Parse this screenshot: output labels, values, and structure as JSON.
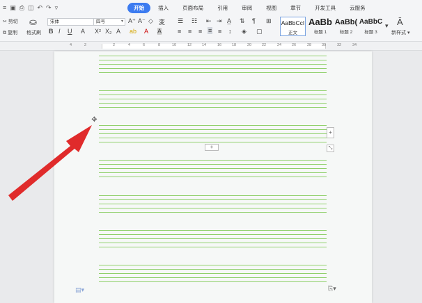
{
  "quick_access": {
    "icons": [
      "menu-icon",
      "save-icon",
      "print-icon",
      "preview-icon",
      "undo-icon",
      "redo-icon",
      "customize-icon"
    ]
  },
  "tabs": [
    {
      "label": "开始",
      "active": true
    },
    {
      "label": "插入"
    },
    {
      "label": "页面布局"
    },
    {
      "label": "引用"
    },
    {
      "label": "审阅"
    },
    {
      "label": "视图"
    },
    {
      "label": "章节"
    },
    {
      "label": "开发工具"
    },
    {
      "label": "云服务"
    }
  ],
  "ribbon": {
    "cut_label": "剪切",
    "copy_label": "复制",
    "format_painter_label": "格式刷",
    "font_name": "宋体",
    "font_size": "四号",
    "styles": [
      {
        "sample": "AaBbCcI",
        "caption": "正文"
      },
      {
        "sample": "AaBb",
        "caption": "标题 1"
      },
      {
        "sample": "AaBb(",
        "caption": "标题 2"
      },
      {
        "sample": "AaBbC",
        "caption": "标题 3"
      }
    ],
    "new_style_label": "新样式"
  },
  "ruler": {
    "ticks": [
      "4",
      "2",
      "2",
      "4",
      "6",
      "8",
      "10",
      "12",
      "14",
      "16",
      "18",
      "20",
      "22",
      "24",
      "26",
      "28",
      "30",
      "32",
      "34"
    ]
  },
  "table_controls": {
    "move_handle": "✥",
    "add_row": "+",
    "add_column": "+",
    "resize": "⤡"
  },
  "colors": {
    "accent": "#3c7bf0",
    "ruled_line": "#8fd06a",
    "arrow": "#e02b2b"
  }
}
